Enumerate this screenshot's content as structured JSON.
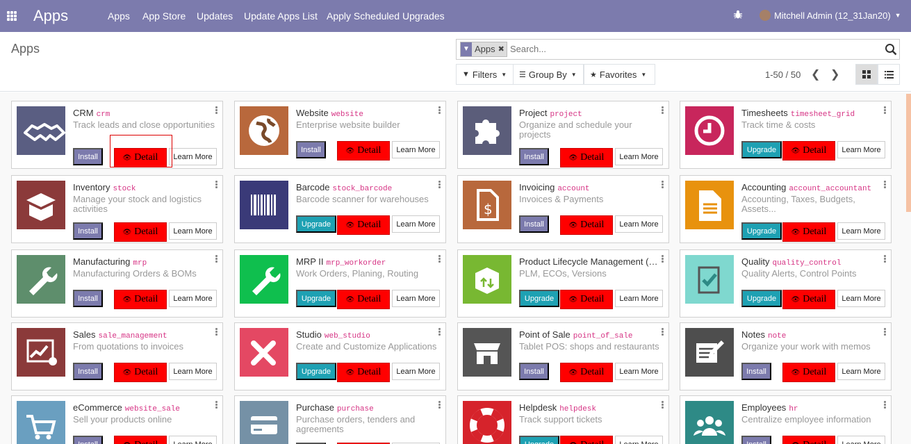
{
  "topbar": {
    "brand": "Apps",
    "menu": [
      "Apps",
      "App Store",
      "Updates",
      "Update Apps List",
      "Apply Scheduled Upgrades"
    ],
    "user": "Mitchell Admin (12_31Jan20)",
    "color": "#7c7bad"
  },
  "control_panel": {
    "breadcrumb": "Apps",
    "facet_label": "Apps",
    "search_placeholder": "Search...",
    "filters_label": "Filters",
    "groupby_label": "Group By",
    "favorites_label": "Favorites",
    "pager": "1-50 / 50"
  },
  "buttons": {
    "install": "Install",
    "upgrade": "Upgrade",
    "detail": "Detail",
    "learn_more": "Learn More"
  },
  "apps": [
    {
      "name": "CRM",
      "tech": "crm",
      "summary": "Track leads and close opportunities",
      "action": "install",
      "icon": "handshake-icon",
      "color": "#5a5e82"
    },
    {
      "name": "Website",
      "tech": "website",
      "summary": "Enterprise website builder",
      "action": "install",
      "icon": "globe-icon",
      "color": "#b8683c"
    },
    {
      "name": "Project",
      "tech": "project",
      "summary": "Organize and schedule your projects",
      "action": "install",
      "icon": "puzzle-icon",
      "color": "#5b5d7a"
    },
    {
      "name": "Timesheets",
      "tech": "timesheet_grid",
      "summary": "Track time & costs",
      "action": "upgrade",
      "icon": "clock-icon",
      "color": "#c8265c"
    },
    {
      "name": "Inventory",
      "tech": "stock",
      "summary": "Manage your stock and logistics activities",
      "action": "install",
      "icon": "box-icon",
      "color": "#8b3a3a"
    },
    {
      "name": "Barcode",
      "tech": "stock_barcode",
      "summary": "Barcode scanner for warehouses",
      "action": "upgrade",
      "icon": "barcode-icon",
      "color": "#3a3a78"
    },
    {
      "name": "Invoicing",
      "tech": "account",
      "summary": "Invoices & Payments",
      "action": "install",
      "icon": "invoice-icon",
      "color": "#b8683c"
    },
    {
      "name": "Accounting",
      "tech": "account_accountant",
      "summary": "Accounting, Taxes, Budgets, Assets...",
      "action": "upgrade",
      "icon": "document-icon",
      "color": "#e8920e"
    },
    {
      "name": "Manufacturing",
      "tech": "mrp",
      "summary": "Manufacturing Orders & BOMs",
      "action": "install",
      "icon": "wrench-icon",
      "color": "#5e8e6c"
    },
    {
      "name": "MRP II",
      "tech": "mrp_workorder",
      "summary": "Work Orders, Planing, Routing",
      "action": "upgrade",
      "icon": "wrench-icon",
      "color": "#0fbf4e"
    },
    {
      "name": "Product Lifecycle Management (PLM)",
      "tech": "",
      "summary": "PLM, ECOs, Versions",
      "action": "upgrade",
      "icon": "box-arrows-icon",
      "color": "#78b832"
    },
    {
      "name": "Quality",
      "tech": "quality_control",
      "summary": "Quality Alerts, Control Points",
      "action": "upgrade",
      "icon": "clipboard-check-icon",
      "color": "#7fd8cf"
    },
    {
      "name": "Sales",
      "tech": "sale_management",
      "summary": "From quotations to invoices",
      "action": "install",
      "icon": "chart-gear-icon",
      "color": "#8b3a3a"
    },
    {
      "name": "Studio",
      "tech": "web_studio",
      "summary": "Create and Customize Applications",
      "action": "upgrade",
      "icon": "tools-icon",
      "color": "#e44863"
    },
    {
      "name": "Point of Sale",
      "tech": "point_of_sale",
      "summary": "Tablet POS: shops and restaurants",
      "action": "install",
      "icon": "shop-icon",
      "color": "#555555"
    },
    {
      "name": "Notes",
      "tech": "note",
      "summary": "Organize your work with memos",
      "action": "install",
      "icon": "note-icon",
      "color": "#4e4e4e"
    },
    {
      "name": "eCommerce",
      "tech": "website_sale",
      "summary": "Sell your products online",
      "action": "install",
      "icon": "cart-icon",
      "color": "#6a9fc0"
    },
    {
      "name": "Purchase",
      "tech": "purchase",
      "summary": "Purchase orders, tenders and agreements",
      "action": "install",
      "icon": "card-icon",
      "color": "#7591a6"
    },
    {
      "name": "Helpdesk",
      "tech": "helpdesk",
      "summary": "Track support tickets",
      "action": "upgrade",
      "icon": "lifebuoy-icon",
      "color": "#d6232b"
    },
    {
      "name": "Employees",
      "tech": "hr",
      "summary": "Centralize employee information",
      "action": "install",
      "icon": "users-icon",
      "color": "#2e8a86"
    }
  ]
}
